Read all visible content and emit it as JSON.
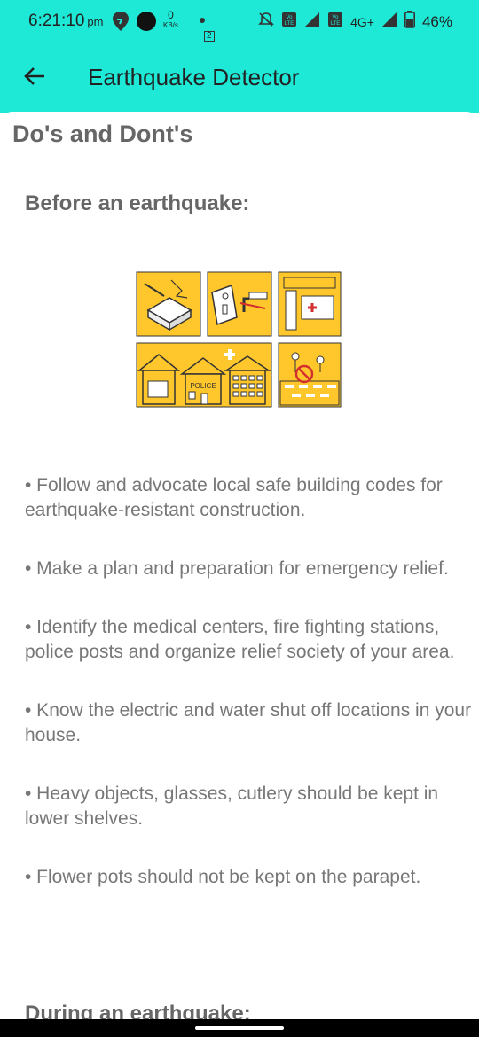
{
  "status_bar": {
    "time": "6:21:10",
    "ampm": "pm",
    "speed_value": "0",
    "speed_unit": "KB/s",
    "notif_count": "2",
    "network": "4G+",
    "battery": "46%"
  },
  "app_bar": {
    "title": "Earthquake Detector"
  },
  "page": {
    "section_title": "Do's and Dont's",
    "subheading": "Before an earthquake:",
    "illustration_label": "POLICE",
    "bullets": [
      "• Follow and advocate local safe building codes for earthquake-resistant construction.",
      "• Make a plan and preparation for emergency relief.",
      "• Identify the medical centers, fire fighting stations, police posts and organize relief society of your area.",
      "• Know the electric and water shut off locations in your house.",
      "• Heavy objects, glasses, cutlery should be kept in lower shelves.",
      "• Flower pots should not be kept on the parapet."
    ],
    "next_heading": "During an earthquake:"
  },
  "colors": {
    "accent": "#1de9d6",
    "illustration_yellow": "#ffc72c",
    "text_gray": "#777777"
  }
}
